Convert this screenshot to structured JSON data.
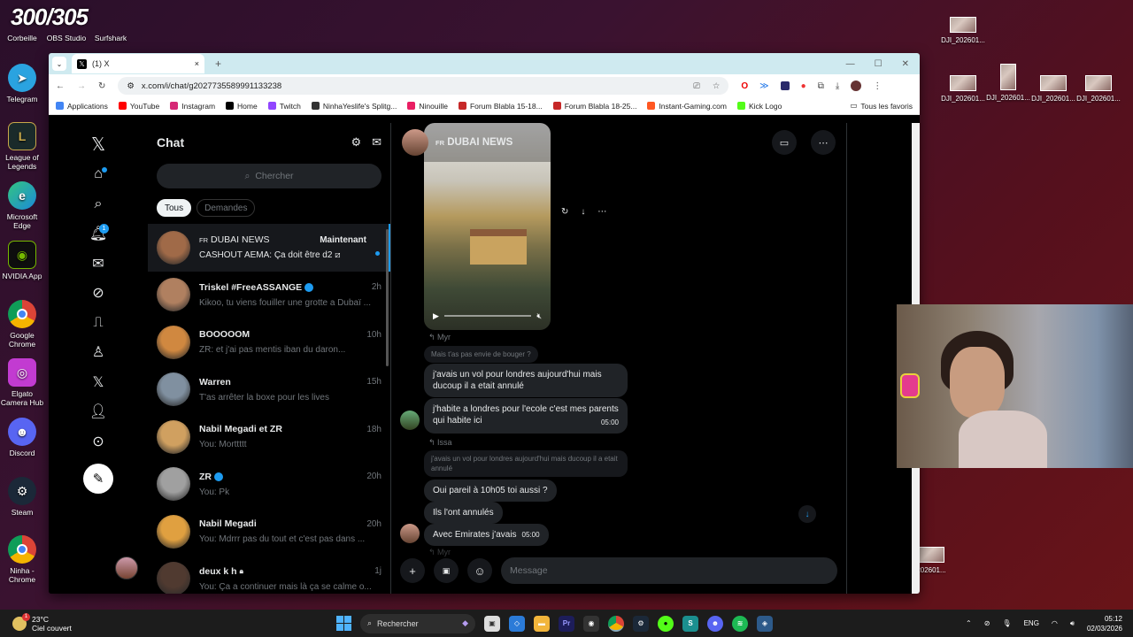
{
  "desktop": {
    "top_icons": [
      {
        "label": "Corbeille"
      },
      {
        "label": "OBS Studio"
      },
      {
        "label": "Surfshark"
      }
    ],
    "logo_overlay": "300/305",
    "left_icons": [
      {
        "label": "Telegram",
        "icon": "telegram-icon"
      },
      {
        "label": "League of Legends",
        "icon": "lol-icon"
      },
      {
        "label": "Microsoft Edge",
        "icon": "edge-icon"
      },
      {
        "label": "NVIDIA App",
        "icon": "nvidia-icon"
      },
      {
        "label": "Google Chrome",
        "icon": "chrome-icon"
      },
      {
        "label": "Elgato Camera Hub",
        "icon": "elgato-icon"
      },
      {
        "label": "Discord",
        "icon": "discord-icon"
      },
      {
        "label": "Steam",
        "icon": "steam-icon"
      },
      {
        "label": "Ninha - Chrome",
        "icon": "chrome-icon"
      }
    ],
    "right_thumbs": [
      {
        "label": "DJI_202601..."
      },
      {
        "label": "DJI_202601..."
      },
      {
        "label": "DJI_202601..."
      },
      {
        "label": "DJI_202601..."
      },
      {
        "label": "DJI_202601..."
      },
      {
        "label": "DJI_202601..."
      },
      {
        "label": "202601..."
      }
    ]
  },
  "browser": {
    "tab_title": "(1) X",
    "tab_close": "×",
    "new_tab": "+",
    "url": "x.com/i/chat/g2027735589991133238",
    "bookmarks": [
      {
        "label": "Applications",
        "color": "#4285f4"
      },
      {
        "label": "YouTube",
        "color": "#ff0000"
      },
      {
        "label": "Instagram",
        "color": "#d62976"
      },
      {
        "label": "Home",
        "color": "#000000"
      },
      {
        "label": "Twitch",
        "color": "#9146ff"
      },
      {
        "label": "NinhaYeslife's Splitg...",
        "color": "#333333"
      },
      {
        "label": "Ninouille",
        "color": "#e91e63"
      },
      {
        "label": "Forum Blabla 15-18...",
        "color": "#c62828"
      },
      {
        "label": "Forum Blabla 18-25...",
        "color": "#c62828"
      },
      {
        "label": "Instant-Gaming.com",
        "color": "#ff5722"
      },
      {
        "label": "Kick Logo",
        "color": "#53fc18"
      }
    ],
    "bookmarks_end": "Tous les favoris"
  },
  "x": {
    "nav_badge": "1",
    "chat_title": "Chat",
    "search_placeholder": "Chercher",
    "filters": [
      "Tous",
      "Demandes"
    ],
    "conversations": [
      {
        "name": "DUBAI NEWS",
        "flag": "FR",
        "time": "Maintenant",
        "preview": "CASHOUT AEMA: Ça doit être d2 ⧄",
        "color": "#a06a48",
        "selected": true,
        "unread": true
      },
      {
        "name": "Triskel #FreeASSANGE",
        "time": "2h",
        "preview": "Kikoo, tu viens fouiller une grotte a Dubaï ...",
        "color": "#b08060",
        "verified": true
      },
      {
        "name": "BOOOOOM",
        "time": "10h",
        "preview": "ZR: et j'ai pas mentis iban du daron...",
        "color": "#d08840"
      },
      {
        "name": "Warren",
        "time": "15h",
        "preview": "T'as arrêter la boxe pour les lives",
        "color": "#8090a0"
      },
      {
        "name": "Nabil Megadi et ZR",
        "time": "18h",
        "preview": "You: Morttttt",
        "color": "#d0a060"
      },
      {
        "name": "ZR",
        "time": "20h",
        "preview": "You: Pk",
        "color": "#a0a0a0",
        "verified": true
      },
      {
        "name": "Nabil Megadi",
        "time": "20h",
        "preview": "You: Mdrrr pas du tout et c'est pas dans ...",
        "color": "#e0a040"
      },
      {
        "name": "deux k h",
        "time": "1j",
        "preview": "You: Ça a continuer mais là ça se calme o...",
        "color": "#503a30",
        "locked": true
      }
    ],
    "convo": {
      "name": "DUBAI NEWS",
      "flag": "FR",
      "reply1": "↰ Myr",
      "quote1": "Mais t'as pas envie de bouger ?",
      "msg1": "j'avais un vol pour londres aujourd'hui mais ducoup il a etait annulé",
      "msg2": "j'habite a londres pour l'ecole c'est mes parents qui habite ici",
      "msg2_time": "05:00",
      "reply2": "↰ Issa",
      "quote2": "j'avais un vol pour londres aujourd'hui mais ducoup il a etait annulé",
      "msg3": "Oui pareil à 10h05 toi aussi ?",
      "msg4": "Ils l'ont annulés",
      "msg5": "Avec Emirates j'avais",
      "msg5_time": "05:00",
      "reply3": "↰ Myr",
      "input_placeholder": "Message"
    }
  },
  "taskbar": {
    "temp": "23°C",
    "weather": "Ciel couvert",
    "weather_badge": "1",
    "search": "Rechercher",
    "lang": "ENG",
    "time": "05:12",
    "date": "02/03/2026"
  }
}
